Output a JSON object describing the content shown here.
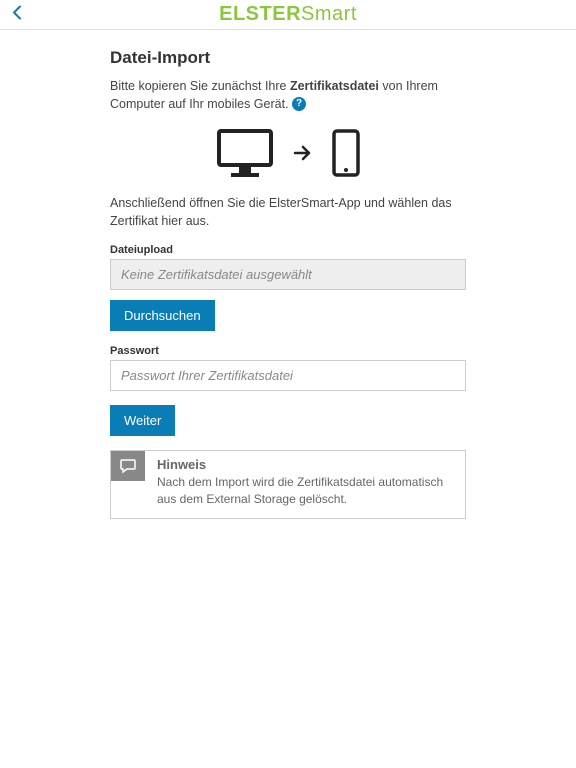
{
  "header": {
    "logo_bold": "ELSTER",
    "logo_light": "Smart"
  },
  "page": {
    "title": "Datei-Import",
    "intro_pre": "Bitte kopieren Sie zunächst Ihre ",
    "intro_bold": "Zertifikatsdatei",
    "intro_post": " von Ihrem Computer auf Ihr mobiles Gerät. ",
    "sub_text": "Anschließend öffnen Sie die ElsterSmart-App und wählen das Zertifikat hier aus."
  },
  "file_upload": {
    "label": "Dateiupload",
    "placeholder": "Keine Zertifikatsdatei ausgewählt",
    "browse_button": "Durchsuchen"
  },
  "password": {
    "label": "Passwort",
    "placeholder": "Passwort Ihrer Zertifikatsdatei"
  },
  "continue_button": "Weiter",
  "hint": {
    "title": "Hinweis",
    "text": "Nach dem Import wird die Zertifikatsdatei automatisch aus dem External Storage gelöscht."
  }
}
